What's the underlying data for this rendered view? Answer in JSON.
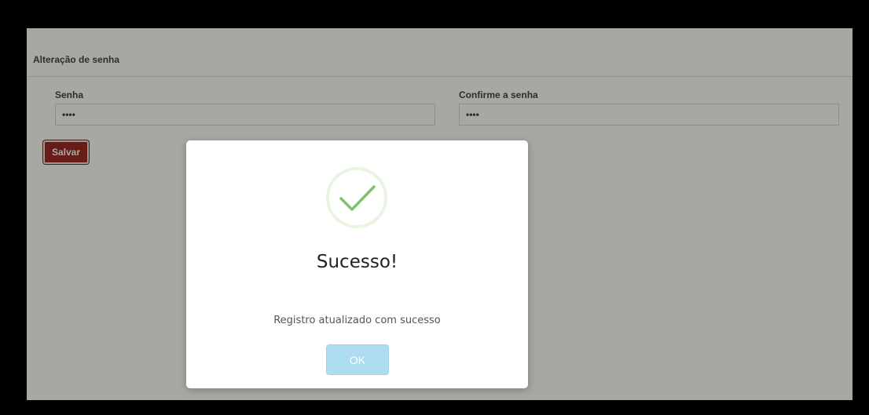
{
  "form": {
    "title": "Alteração de senha",
    "password_label": "Senha",
    "password_value": "••••",
    "confirm_label": "Confirme a senha",
    "confirm_value": "••••",
    "save_label": "Salvar"
  },
  "dialog": {
    "icon": "success-check-icon",
    "title": "Sucesso!",
    "message": "Registro atualizado com sucesso",
    "ok_label": "OK"
  },
  "colors": {
    "save_button": "#8b0000",
    "success_check": "#7ac56a",
    "ok_button": "#aedcf0"
  }
}
